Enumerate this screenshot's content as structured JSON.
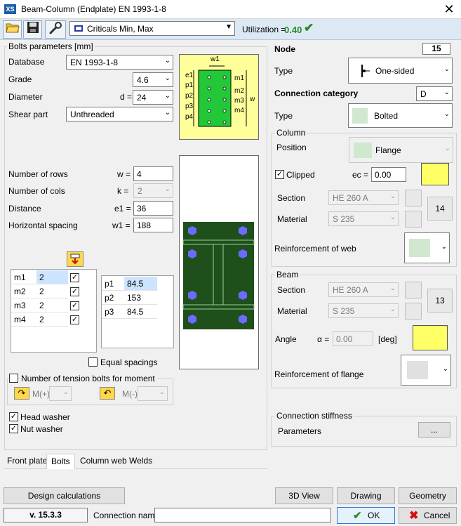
{
  "window": {
    "title": "Beam-Column (Endplate) EN 1993-1-8",
    "logo": "XS",
    "close_glyph": "✕"
  },
  "toolbar": {
    "criticals": "Criticals Min, Max",
    "utilization_label": "Utilization =",
    "utilization_value": "0.40",
    "ok_glyph": "✔"
  },
  "bolts": {
    "group_title": "Bolts parameters [mm]",
    "database_label": "Database",
    "database_value": "EN 1993-1-8",
    "grade_label": "Grade",
    "grade_value": "4.6",
    "diameter_label": "Diameter",
    "diameter_symbol": "d =",
    "diameter_value": "24",
    "shear_label": "Shear part",
    "shear_value": "Unthreaded",
    "rows_label": "Number of rows",
    "rows_symbol": "w =",
    "rows_value": "4",
    "cols_label": "Number of cols",
    "cols_symbol": "k =",
    "cols_value": "2",
    "distance_label": "Distance",
    "distance_symbol": "e1 =",
    "distance_value": "36",
    "hspacing_label": "Horizontal spacing",
    "hspacing_symbol": "w1 =",
    "hspacing_value": "188",
    "m_rows": [
      {
        "name": "m1",
        "value": "2",
        "checked": true
      },
      {
        "name": "m2",
        "value": "2",
        "checked": true
      },
      {
        "name": "m3",
        "value": "2",
        "checked": true
      },
      {
        "name": "m4",
        "value": "2",
        "checked": true
      }
    ],
    "p_rows": [
      {
        "name": "p1",
        "value": "84.5"
      },
      {
        "name": "p2",
        "value": "153"
      },
      {
        "name": "p3",
        "value": "84.5"
      }
    ],
    "equal_spacings": "Equal spacings",
    "tension_bolts": "Number of tension bolts for moment",
    "m_plus": "M(+)",
    "m_minus": "M(-)",
    "head_washer": "Head washer",
    "nut_washer": "Nut washer",
    "diagram_labels": {
      "w1": "w1",
      "e1": "e1",
      "p1": "p1",
      "p2": "p2",
      "p3": "p3",
      "p4": "p4",
      "m1": "m1",
      "m2": "m2",
      "m3": "m3",
      "m4": "m4",
      "w": "w"
    }
  },
  "tabs": [
    "Front plate",
    "Bolts",
    "Column web",
    "Welds"
  ],
  "active_tab": "Bolts",
  "node": {
    "label": "Node",
    "value": "15",
    "type_label": "Type",
    "type_value": "One-sided",
    "category_label": "Connection category",
    "category_value": "D",
    "category_type_label": "Type",
    "category_type_value": "Bolted"
  },
  "column": {
    "title": "Column",
    "position_label": "Position",
    "position_value": "Flange",
    "clipped_label": "Clipped",
    "ec_symbol": "ec =",
    "ec_value": "0.00",
    "section_label": "Section",
    "section_value": "HE 260 A",
    "material_label": "Material",
    "material_value": "S 235",
    "member_number": "14",
    "reinf_web_label": "Reinforcement of web"
  },
  "beam": {
    "title": "Beam",
    "section_label": "Section",
    "section_value": "HE 260 A",
    "material_label": "Material",
    "material_value": "S 235",
    "member_number": "13",
    "angle_label": "Angle",
    "alpha_symbol": "α =",
    "angle_value": "0.00",
    "angle_unit": "[deg]",
    "reinf_flange_label": "Reinforcement of flange"
  },
  "stiffness": {
    "title": "Connection stiffness",
    "parameters_label": "Parameters",
    "dots": "..."
  },
  "footer": {
    "design_calc": "Design calculations",
    "view3d": "3D View",
    "drawing": "Drawing",
    "geometry": "Geometry",
    "version": "v. 15.3.3",
    "conn_name_label": "Connection name",
    "conn_name_value": "",
    "ok": "OK",
    "cancel": "Cancel"
  },
  "colors": {
    "accent_green": "#2a8a2a",
    "toolbar_bg": "#dde8f5",
    "plate_green": "#1f4f1a",
    "bolt_blue": "#6b6bff",
    "diagram_yellow": "#ffff9a"
  }
}
